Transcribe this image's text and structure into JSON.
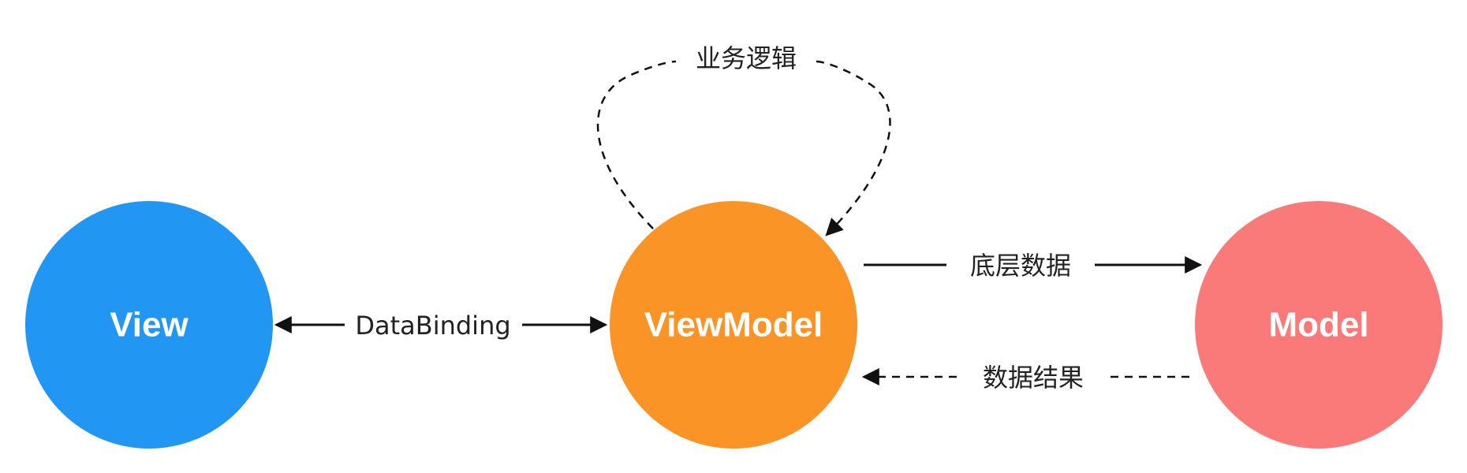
{
  "nodes": {
    "view": {
      "label": "View",
      "color": "#2196f3"
    },
    "viewmodel": {
      "label": "ViewModel",
      "color": "#fa9427"
    },
    "model": {
      "label": "Model",
      "color": "#f97a79"
    }
  },
  "edges": {
    "databinding": {
      "label": "DataBinding",
      "style": "solid",
      "direction": "bidirectional"
    },
    "business_logic": {
      "label": "业务逻辑",
      "style": "dashed",
      "direction": "self-loop"
    },
    "underlying_data": {
      "label": "底层数据",
      "style": "solid",
      "direction": "viewmodel-to-model"
    },
    "data_result": {
      "label": "数据结果",
      "style": "dashed",
      "direction": "model-to-viewmodel"
    }
  },
  "colors": {
    "line": "#111111",
    "text": "#222222",
    "background": "#ffffff"
  }
}
